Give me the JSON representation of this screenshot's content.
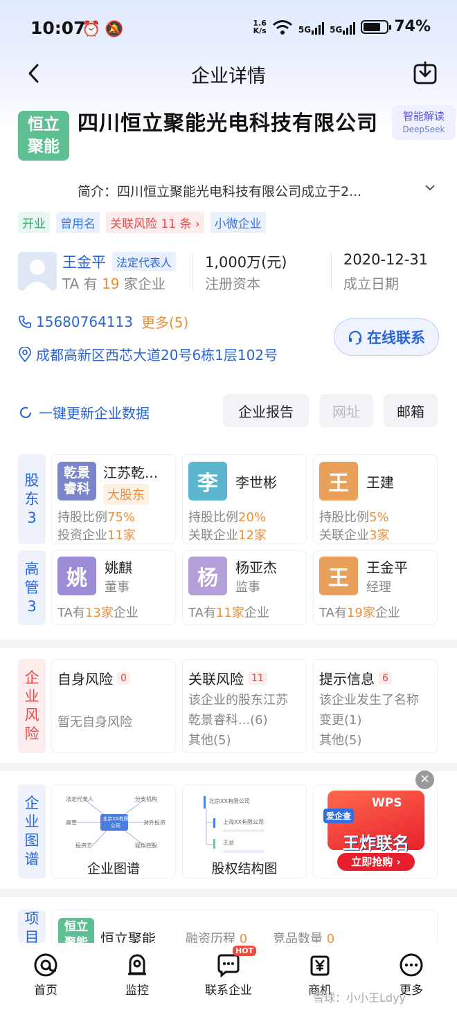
{
  "status_bar": {
    "time": "10:07",
    "net_speed_top": "1.6",
    "net_speed_bottom": "K/s",
    "sim1": "5G",
    "sim2": "5G",
    "battery": "74%",
    "battery_level": 0.74
  },
  "header": {
    "title": "企业详情"
  },
  "company": {
    "logo_line1": "恒立",
    "logo_line2": "聚能",
    "name": "四川恒立聚能光电科技有限公司",
    "ai_title": "智能解读",
    "ai_sub": "DeepSeek",
    "intro": "简介：四川恒立聚能光电科技有限公司成立于2...",
    "tags": [
      "开业",
      "曾用名",
      "关联风险 11 条 ›",
      "小微企业"
    ]
  },
  "legal_person": {
    "name": "王金平",
    "badge": "法定代表人",
    "sub_prefix": "TA 有 ",
    "sub_count": "19",
    "sub_suffix": " 家企业"
  },
  "capital": {
    "value": "1,000万(元)",
    "label": "注册资本"
  },
  "founded": {
    "value": "2020-12-31",
    "label": "成立日期"
  },
  "contact": {
    "phone": "15680764113",
    "phone_more": "更多(5)",
    "address": "成都高新区西芯大道20号6栋1层102号",
    "online_button": "在线联系"
  },
  "actions": {
    "refresh": "一键更新企业数据",
    "report": "企业报告",
    "website": "网址",
    "email": "邮箱"
  },
  "shareholders": {
    "side_label": [
      "股",
      "东",
      "3"
    ],
    "items": [
      {
        "avatar_l1": "乾景",
        "avatar_l2": "睿科",
        "name": "江苏乾...",
        "tag": "大股东",
        "line1_prefix": "持股比例",
        "line1_value": "75%",
        "line2_prefix": "投资企业",
        "line2_value": "11家",
        "color": "#7a86c9"
      },
      {
        "avatar": "李",
        "name": "李世彬",
        "line1_prefix": "持股比例",
        "line1_value": "20%",
        "line2_prefix": "关联企业",
        "line2_value": "12家",
        "color": "#5bb5cf"
      },
      {
        "avatar": "王",
        "name": "王建",
        "line1_prefix": "持股比例",
        "line1_value": "5%",
        "line2_prefix": "关联企业",
        "line2_value": "3家",
        "color": "#e8a05a"
      }
    ]
  },
  "executives": {
    "side_label": [
      "高",
      "管",
      "3"
    ],
    "items": [
      {
        "avatar": "姚",
        "name": "姚麒",
        "role": "董事",
        "line_prefix": "TA有",
        "line_value": "13家",
        "line_suffix": "企业",
        "color": "#9c8bd6"
      },
      {
        "avatar": "杨",
        "name": "杨亚杰",
        "role": "监事",
        "line_prefix": "TA有",
        "line_value": "11家",
        "line_suffix": "企业",
        "color": "#b4a0d8"
      },
      {
        "avatar": "王",
        "name": "王金平",
        "role": "经理",
        "line_prefix": "TA有",
        "line_value": "19家",
        "line_suffix": "企业",
        "color": "#e8a05a"
      }
    ]
  },
  "risk": {
    "side_label": [
      "企",
      "业",
      "风",
      "险"
    ],
    "items": [
      {
        "title": "自身风险",
        "count": "0",
        "lines": [
          "暂无自身风险"
        ]
      },
      {
        "title": "关联风险",
        "count": "11",
        "lines": [
          "该企业的股东江苏",
          "乾景睿科...(6)",
          "其他(5)"
        ]
      },
      {
        "title": "提示信息",
        "count": "6",
        "lines": [
          "该企业发生了名称",
          "变更(1)",
          "其他(5)"
        ]
      }
    ]
  },
  "graph": {
    "side_label": [
      "企",
      "业",
      "图",
      "谱"
    ],
    "card1_label": "企业图谱",
    "card1_center": "北京XX有限公司",
    "card1_nodes": [
      "法定代表人",
      "分支机构",
      "高管",
      "对外投资",
      "投资方",
      "疑似控股"
    ],
    "card2_label": "股权结构图",
    "card2_rows": [
      "北京XX有限公司",
      "上海XX有限公司",
      "王总"
    ],
    "ad_top": "WPS",
    "ad_badge": "爱企查",
    "ad_main": "王炸联名",
    "ad_btn": "立即抢购 ›"
  },
  "project": {
    "side_label": [
      "项",
      "目"
    ],
    "logo_l1": "恒立",
    "logo_l2": "聚能",
    "name": "恒立聚能",
    "financing_label": "融资历程",
    "financing_value": "0",
    "competitor_label": "竞品数量",
    "competitor_value": "0"
  },
  "nav": {
    "items": [
      {
        "label": "首页",
        "icon": "home-at-icon"
      },
      {
        "label": "监控",
        "icon": "monitor-icon"
      },
      {
        "label": "联系企业",
        "icon": "chat-icon",
        "badge": "HOT"
      },
      {
        "label": "商机",
        "icon": "yen-icon"
      },
      {
        "label": "更多",
        "icon": "more-icon"
      }
    ]
  },
  "watermark": "雪球：小小王Ldyy"
}
